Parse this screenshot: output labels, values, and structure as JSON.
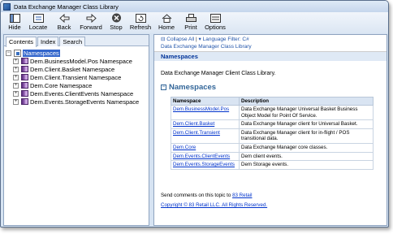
{
  "window": {
    "title": "Data Exchange Manager Class Library"
  },
  "toolbar": [
    {
      "label": "Hide",
      "icon": "hide-icon"
    },
    {
      "label": "Locate",
      "icon": "locate-icon"
    },
    {
      "label": "Back",
      "icon": "back-arrow-icon"
    },
    {
      "label": "Forward",
      "icon": "forward-arrow-icon"
    },
    {
      "label": "Stop",
      "icon": "stop-icon"
    },
    {
      "label": "Refresh",
      "icon": "refresh-icon"
    },
    {
      "label": "Home",
      "icon": "home-icon"
    },
    {
      "label": "Print",
      "icon": "print-icon"
    },
    {
      "label": "Options",
      "icon": "options-icon"
    }
  ],
  "tabs": [
    "Contents",
    "Index",
    "Search"
  ],
  "tree": {
    "root": "Namespaces",
    "children": [
      "Dem.BusinessModel.Pos Namespace",
      "Dem.Client.Basket Namespace",
      "Dem.Client.Transient Namespace",
      "Dem.Core Namespace",
      "Dem.Events.ClientEvents Namespace",
      "Dem.Events.StorageEvents Namespace"
    ]
  },
  "content": {
    "collapse_all": "Collapse All",
    "language_filter": "Language Filter: C#",
    "library_name": "Data Exchange Manager Class Library",
    "header": "Namespaces",
    "description": "Data Exchange Manager Client Class Library.",
    "section_title": "Namespaces",
    "table": {
      "headers": [
        "Namespace",
        "Description"
      ],
      "rows": [
        [
          "Dem.BusinessModel.Pos",
          "Data Exchange Manager Universal Basket Business Object Model for Point Of Service."
        ],
        [
          "Dem.Client.Basket",
          "Data Exchange Manager client for Universal Basket."
        ],
        [
          "Dem.Client.Transient",
          "Data Exchange Manager client for in-flight / POS transitional data."
        ],
        [
          "Dem.Core",
          "Data Exchange Manager core classes."
        ],
        [
          "Dem.Events.ClientEvents",
          "Dem client events."
        ],
        [
          "Dem.Events.StorageEvents",
          "Dem Storage events."
        ]
      ]
    },
    "feedback_text": "Send comments on this topic to",
    "feedback_link": "83 Retail",
    "copyright": "Copyright © 83 Retail LLC. All Rights Reserved."
  }
}
